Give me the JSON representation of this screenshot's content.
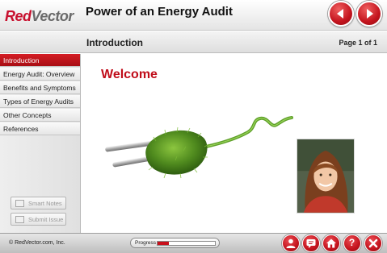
{
  "header": {
    "logo_red": "Red",
    "logo_gray": "Vector",
    "course_title": "Power of an Energy Audit",
    "prev_icon": "chevron-left-icon",
    "next_icon": "chevron-right-icon"
  },
  "subheader": {
    "section_title": "Introduction",
    "page_indicator": "Page 1 of 1"
  },
  "sidebar": {
    "items": [
      {
        "label": "Introduction",
        "active": true
      },
      {
        "label": "Energy Audit: Overview",
        "active": false
      },
      {
        "label": "Benefits and Symptoms",
        "active": false
      },
      {
        "label": "Types of Energy Audits",
        "active": false
      },
      {
        "label": "Other Concepts",
        "active": false
      },
      {
        "label": "References",
        "active": false
      }
    ],
    "smart_notes_label": "Smart Notes",
    "submit_issue_label": "Submit Issue"
  },
  "main": {
    "heading": "Welcome"
  },
  "footer": {
    "copyright": "© RedVector.com, Inc.",
    "progress_label": "Progress",
    "progress_fraction": 0.2,
    "buttons": [
      "person-icon",
      "chat-icon",
      "home-icon",
      "help-icon",
      "close-icon"
    ]
  },
  "colors": {
    "brand_red": "#c8102e",
    "heading_red": "#c00d1a",
    "grass_green": "#4f8a1e"
  }
}
